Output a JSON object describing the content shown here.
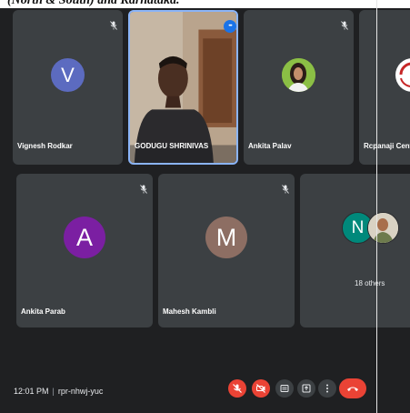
{
  "caption": "(North & South) and Karnataka.",
  "participants": [
    {
      "name": "Vignesh Rodkar",
      "initial": "V",
      "color": "#5c6bc0"
    },
    {
      "name": "GODUGU SHRINIVAS",
      "initial": "",
      "color": ""
    },
    {
      "name": "Ankita Palav",
      "initial": "",
      "color": ""
    },
    {
      "name": "Rcpanaji Centre",
      "initial": "",
      "color": ""
    },
    {
      "name": "Ankita Parab",
      "initial": "A",
      "color": "#7b1fa2"
    },
    {
      "name": "Mahesh Kambli",
      "initial": "M",
      "color": "#8d6e63"
    }
  ],
  "others": {
    "initial": "N",
    "color": "#00897b",
    "label": "18 others"
  },
  "meeting": {
    "time": "12:01 PM",
    "separator": "|",
    "code": "rpr-nhwj-yuc"
  },
  "more_glyph": "•••"
}
